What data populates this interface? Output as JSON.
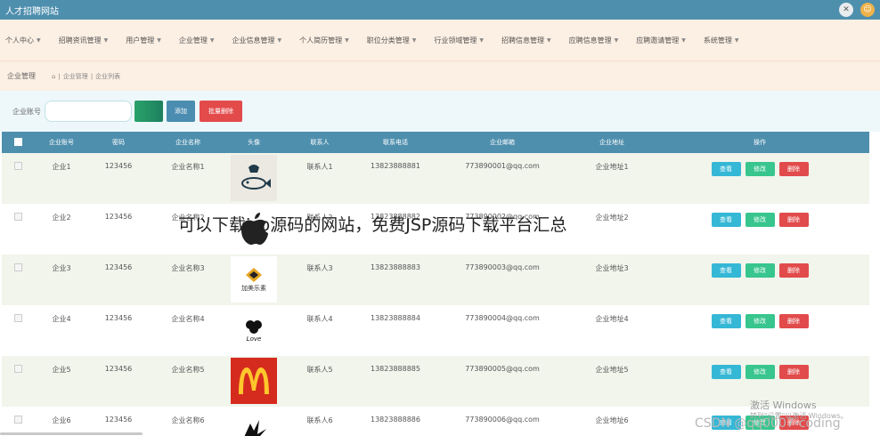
{
  "app": {
    "title": "人才招聘网站"
  },
  "nav": [
    {
      "label": "个人中心"
    },
    {
      "label": "招聘资讯管理"
    },
    {
      "label": "用户管理"
    },
    {
      "label": "企业管理"
    },
    {
      "label": "企业信息管理"
    },
    {
      "label": "个人简历管理"
    },
    {
      "label": "职位分类管理"
    },
    {
      "label": "行业领域管理"
    },
    {
      "label": "招聘信息管理"
    },
    {
      "label": "应聘信息管理"
    },
    {
      "label": "应聘邀请管理"
    },
    {
      "label": "系统管理"
    }
  ],
  "breadcrumb": {
    "title": "企业管理",
    "items": [
      "企业管理",
      "企业列表"
    ],
    "separator": "|"
  },
  "search": {
    "label": "企业账号",
    "value": "",
    "placeholder": "",
    "add_label": "添加",
    "batch_delete_label": "批量删除"
  },
  "table": {
    "headers": [
      "企业账号",
      "密码",
      "企业名称",
      "头像",
      "联系人",
      "联系电话",
      "企业邮箱",
      "企业地址",
      "操作"
    ],
    "rows": [
      {
        "account": "企业1",
        "password": "123456",
        "name": "企业名称1",
        "contact": "联系人1",
        "phone": "13823888881",
        "email": "773890001@qq.com",
        "address": "企业地址1",
        "avatar": "fish-logo"
      },
      {
        "account": "企业2",
        "password": "123456",
        "name": "企业名称2",
        "contact": "联系人2",
        "phone": "13823888882",
        "email": "773890002@qq.com",
        "address": "企业地址2",
        "avatar": "apple-logo"
      },
      {
        "account": "企业3",
        "password": "123456",
        "name": "企业名称3",
        "contact": "联系人3",
        "phone": "13823888883",
        "email": "773890003@qq.com",
        "address": "企业地址3",
        "avatar": "jiamei-logo",
        "avatar_text": "加美乐素"
      },
      {
        "account": "企业4",
        "password": "123456",
        "name": "企业名称4",
        "contact": "联系人4",
        "phone": "13823888884",
        "email": "773890004@qq.com",
        "address": "企业地址4",
        "avatar": "clover-logo",
        "avatar_text": "Love"
      },
      {
        "account": "企业5",
        "password": "123456",
        "name": "企业名称5",
        "contact": "联系人5",
        "phone": "13823888885",
        "email": "773890005@qq.com",
        "address": "企业地址5",
        "avatar": "mcdonalds-logo"
      },
      {
        "account": "企业6",
        "password": "123456",
        "name": "企业名称6",
        "contact": "联系人6",
        "phone": "13823888886",
        "email": "773890006@qq.com",
        "address": "企业地址6",
        "avatar": "bird-logo"
      }
    ],
    "actions": {
      "view": "查看",
      "edit": "修改",
      "delete": "删除"
    }
  },
  "overlay": {
    "caption": "可以下载jsp源码的网站，免费JSP源码下载平台汇总",
    "windows_watermark": "激活 Windows",
    "windows_watermark_sub": "转到\"设置\"以激活 Windows。",
    "csdn_watermark": "CSDN @qq0007-coding"
  },
  "colors": {
    "topbar": "#4f8fae",
    "nav_bg": "#fcefe3",
    "view": "#35b7d6",
    "edit": "#38c58e",
    "delete": "#e24b4b"
  }
}
